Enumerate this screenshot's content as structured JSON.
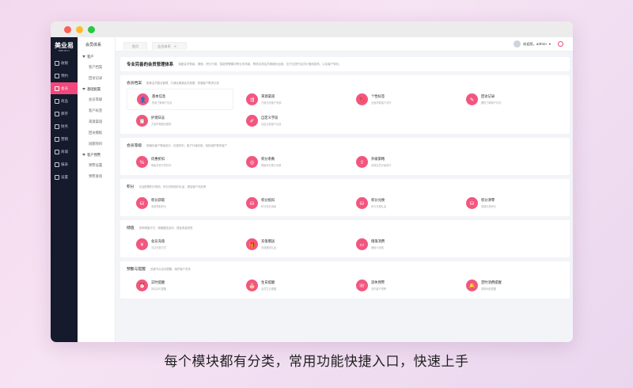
{
  "window": {
    "colors": {
      "accent": "#f2487c",
      "sidebar": "#151a2c"
    }
  },
  "logo": {
    "main": "美业易",
    "sub": "MEIYEYI"
  },
  "nav": [
    {
      "label": "收银",
      "icon": "cashier-icon"
    },
    {
      "label": "预约",
      "icon": "calendar-icon"
    },
    {
      "label": "会员",
      "icon": "member-icon",
      "active": true
    },
    {
      "label": "商品",
      "icon": "goods-icon"
    },
    {
      "label": "库存",
      "icon": "inventory-icon"
    },
    {
      "label": "财务",
      "icon": "finance-icon"
    },
    {
      "label": "营销",
      "icon": "marketing-icon"
    },
    {
      "label": "商城",
      "icon": "mall-icon"
    },
    {
      "label": "报表",
      "icon": "report-icon"
    },
    {
      "label": "设置",
      "icon": "settings-icon"
    }
  ],
  "subnav": {
    "title": "会员体系",
    "groups": [
      {
        "label": "客户",
        "items": [
          "客户档案",
          "回访记录"
        ]
      },
      {
        "label": "基础配置",
        "items": [
          "会员等级",
          "客户标签",
          "来源渠道",
          "回访模板",
          "短期项目"
        ]
      },
      {
        "label": "客户预警",
        "items": [
          "预警设置",
          "预警查询"
        ]
      }
    ]
  },
  "tabs": {
    "home": "首页",
    "current": "会员体系",
    "close": "×"
  },
  "user": {
    "greeting": "欢迎您，admin",
    "caret": "▾"
  },
  "banner": {
    "title": "专业完善的会员管理体系",
    "subtitle": "涵盖会员等级、储值、积分方案、智能预警模块等业务场景，帮助实现会员精细化运营，全方位提升会员价值和复购，以及客户转化。"
  },
  "sections": [
    {
      "title": "会员档案",
      "desc": "聚焦会员整合管理，打通全渠道会员数据，快速客户需求记录",
      "cards": [
        {
          "title": "基本信息",
          "desc": "快速了解客户信息",
          "icon": "👤"
        },
        {
          "title": "来源渠道",
          "desc": "方便分析客户来源",
          "icon": "⇶"
        },
        {
          "title": "个性标签",
          "desc": "全面掌握客户喜好",
          "icon": "🔖"
        },
        {
          "title": "回访记录",
          "desc": "跟踪了解客户情况",
          "icon": "✎"
        },
        {
          "title": "护理日志",
          "desc": "方便护理服务跟踪",
          "icon": "📋"
        },
        {
          "title": "自定义字段",
          "desc": "自由记录客户信息",
          "icon": "✐"
        }
      ]
    },
    {
      "title": "会员等级",
      "desc": "精细化客户等级划分，优惠折扣、客户升级机制，轻松维护更多客户",
      "cards": [
        {
          "title": "优惠折扣",
          "desc": "等级享受不同折扣",
          "icon": "%"
        },
        {
          "title": "积分系数",
          "desc": "等级积分累计系数",
          "icon": "◎"
        },
        {
          "title": "升级策略",
          "desc": "设置会员升级条件",
          "icon": "⇧"
        }
      ]
    },
    {
      "title": "积分",
      "desc": "灵活配置积分规则，积分兑换抵扣礼品，提高客户到店率",
      "cards": [
        {
          "title": "积分获取",
          "desc": "消费获取积分",
          "icon": "⛁"
        },
        {
          "title": "积分抵扣",
          "desc": "积分抵扣消费",
          "icon": "⛁"
        },
        {
          "title": "积分兑换",
          "desc": "积分兑换礼品",
          "icon": "⛁"
        },
        {
          "title": "积分清零",
          "desc": "周期清零积分",
          "icon": "⛁"
        }
      ]
    },
    {
      "title": "储值",
      "desc": "多种储值方式，储值赠送活动，提高资金回笼",
      "cards": [
        {
          "title": "会员充值",
          "desc": "灵活充值方式",
          "icon": "¥"
        },
        {
          "title": "充值赠送",
          "desc": "充值赠送礼品",
          "icon": "🎁"
        },
        {
          "title": "储值消费",
          "desc": "储值卡消费",
          "icon": "▭"
        }
      ]
    },
    {
      "title": "预警与提醒",
      "desc": "关键节点自动提醒，维护客户关系",
      "cards": [
        {
          "title": "实时提醒",
          "desc": "到店实时提醒",
          "icon": "⏰"
        },
        {
          "title": "生日提醒",
          "desc": "会员生日提醒",
          "icon": "🎂"
        },
        {
          "title": "流失预警",
          "desc": "流失客户预警",
          "icon": "☏"
        },
        {
          "title": "定时消费提醒",
          "desc": "周期消费提醒",
          "icon": "🔔"
        }
      ]
    }
  ],
  "caption": "每个模块都有分类，常用功能快捷入口，快速上手"
}
